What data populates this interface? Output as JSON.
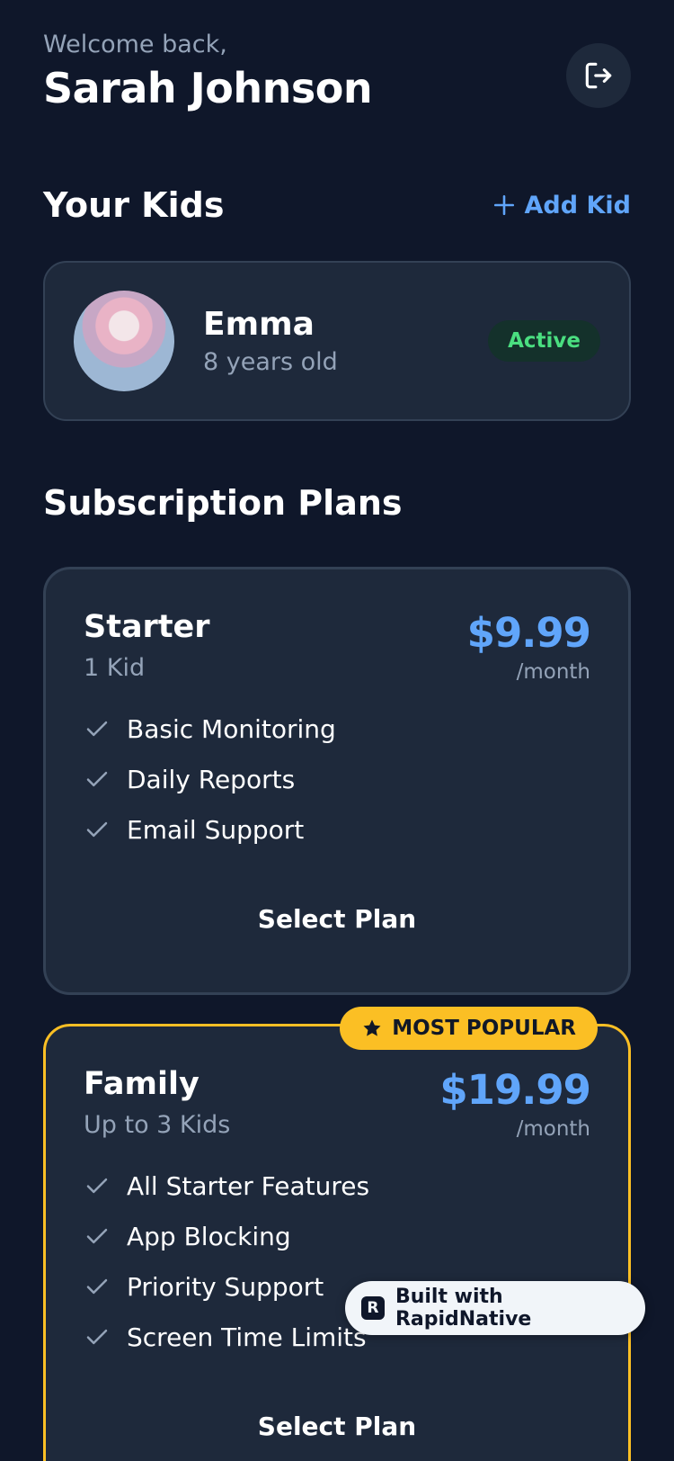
{
  "header": {
    "welcome": "Welcome back,",
    "user_name": "Sarah Johnson"
  },
  "kids_section": {
    "title": "Your Kids",
    "add_label": "Add Kid",
    "kids": [
      {
        "name": "Emma",
        "age": "8 years old",
        "status": "Active"
      }
    ]
  },
  "plans_section": {
    "title": "Subscription Plans",
    "plans": [
      {
        "name": "Starter",
        "subtitle": "1 Kid",
        "price": "$9.99",
        "period": "/month",
        "features": [
          "Basic Monitoring",
          "Daily Reports",
          "Email Support"
        ],
        "cta": "Select Plan"
      },
      {
        "name": "Family",
        "subtitle": "Up to 3 Kids",
        "price": "$19.99",
        "period": "/month",
        "badge": "MOST POPULAR",
        "features": [
          "All Starter Features",
          "App Blocking",
          "Priority Support",
          "Screen Time Limits"
        ],
        "cta": "Select Plan"
      }
    ]
  },
  "built_with": {
    "label": "Built with RapidNative",
    "logo_letter": "R"
  },
  "colors": {
    "background": "#0f172a",
    "card": "#1e293b",
    "accent": "#60a5fa",
    "active": "#4ade80",
    "popular": "#fbbf24"
  },
  "icons": {
    "logout": "logout-icon",
    "add": "plus-icon",
    "check": "check-icon",
    "star": "star-icon"
  }
}
